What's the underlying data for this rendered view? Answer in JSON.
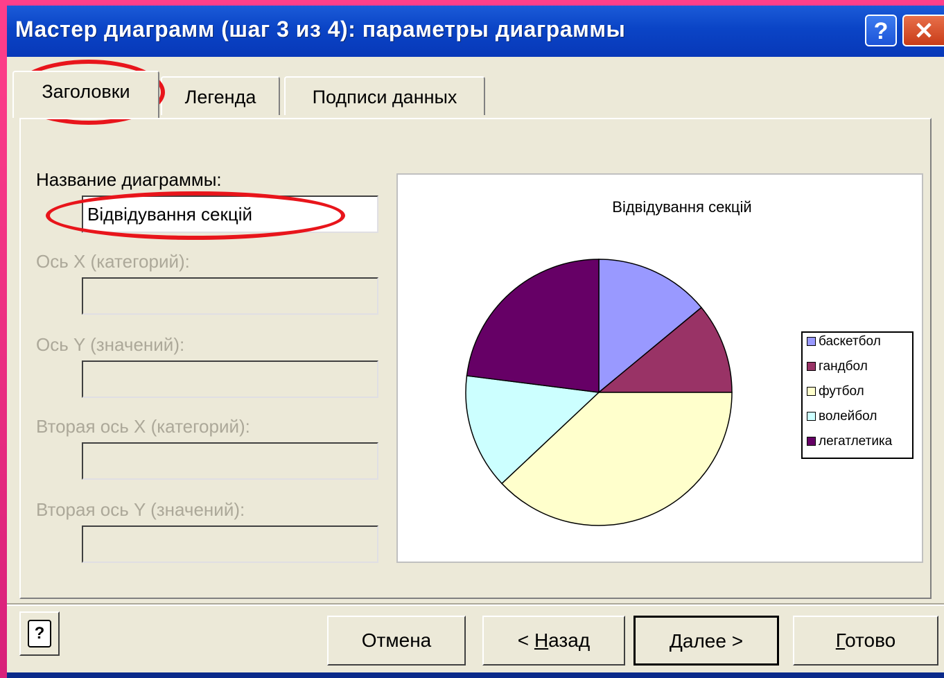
{
  "window": {
    "title": "Мастер диаграмм (шаг 3 из 4): параметры диаграммы",
    "help_glyph": "?",
    "close_glyph": "✕"
  },
  "tabs": [
    {
      "label": "Заголовки",
      "active": true
    },
    {
      "label": "Легенда",
      "active": false
    },
    {
      "label": "Подписи данных",
      "active": false
    }
  ],
  "fields": {
    "chart_title_label": "Название диаграммы:",
    "chart_title_value": "Відвідування секцій",
    "x_axis_label": "Ось X (категорий):",
    "y_axis_label": "Ось Y (значений):",
    "x2_axis_label": "Вторая ось X (категорий):",
    "y2_axis_label": "Вторая ось Y (значений):"
  },
  "preview": {
    "title": "Відвідування секцій",
    "legend": [
      {
        "label": "баскетбол",
        "color": "#9999ff"
      },
      {
        "label": "гандбол",
        "color": "#993366"
      },
      {
        "label": "футбол",
        "color": "#ffffcc"
      },
      {
        "label": "волейбол",
        "color": "#ccffff"
      },
      {
        "label": "легатлетика",
        "color": "#660066"
      }
    ]
  },
  "chart_data": {
    "type": "pie",
    "title": "Відвідування секцій",
    "categories": [
      "баскетбол",
      "гандбол",
      "футбол",
      "волейбол",
      "легатлетика"
    ],
    "values": [
      14,
      11,
      38,
      14,
      23
    ],
    "colors": [
      "#9999ff",
      "#993366",
      "#ffffcc",
      "#ccffff",
      "#660066"
    ],
    "legend": "right"
  },
  "buttons": {
    "help": "?",
    "cancel": "Отмена",
    "back_prefix": "< ",
    "back_ul": "Н",
    "back_rest": "азад",
    "next_ul": "Д",
    "next_rest": "алее >",
    "finish_ul": "Г",
    "finish_rest": "отово"
  }
}
